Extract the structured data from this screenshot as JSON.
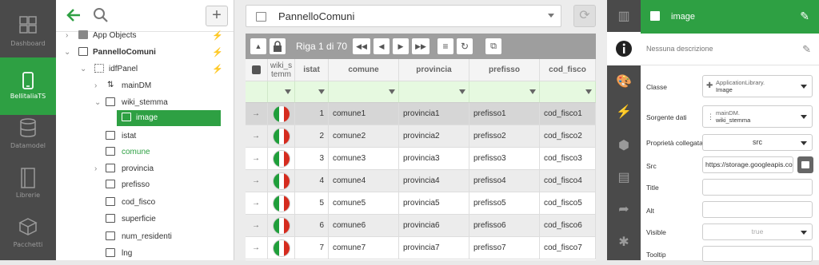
{
  "leftnav": {
    "items": [
      {
        "label": "Dashboard",
        "icon": "dashboard-icon",
        "active": false
      },
      {
        "label": "BellitaliaTS",
        "icon": "phone-icon",
        "active": true
      },
      {
        "label": "Datamodel",
        "icon": "database-icon",
        "active": false
      },
      {
        "label": "Librerie",
        "icon": "book-icon",
        "active": false
      },
      {
        "label": "Pacchetti",
        "icon": "package-icon",
        "active": false
      }
    ]
  },
  "tree": {
    "rows": [
      {
        "label": "App Objects",
        "indent": 1
      },
      {
        "label": "PannelloComuni",
        "indent": 1
      },
      {
        "label": "idfPanel",
        "indent": 2
      },
      {
        "label": "mainDM",
        "indent": 3
      },
      {
        "label": "wiki_stemma",
        "indent": 3
      },
      {
        "label": "image",
        "indent": 4
      },
      {
        "label": "istat",
        "indent": 3
      },
      {
        "label": "comune",
        "indent": 3
      },
      {
        "label": "provincia",
        "indent": 3
      },
      {
        "label": "prefisso",
        "indent": 3
      },
      {
        "label": "cod_fisco",
        "indent": 3
      },
      {
        "label": "superficie",
        "indent": 3
      },
      {
        "label": "num_residenti",
        "indent": 3
      },
      {
        "label": "lng",
        "indent": 3
      }
    ]
  },
  "center": {
    "panel_name": "PannelloComuni",
    "toolbar_text": "Riga 1 di 70",
    "columns": [
      "wiki_s temm",
      "istat",
      "comune",
      "provincia",
      "prefisso",
      "cod_fisco"
    ],
    "rows": [
      {
        "istat": "1",
        "comune": "comune1",
        "provincia": "provincia1",
        "prefisso": "prefisso1",
        "cod_fisco": "cod_fisco1"
      },
      {
        "istat": "2",
        "comune": "comune2",
        "provincia": "provincia2",
        "prefisso": "prefisso2",
        "cod_fisco": "cod_fisco2"
      },
      {
        "istat": "3",
        "comune": "comune3",
        "provincia": "provincia3",
        "prefisso": "prefisso3",
        "cod_fisco": "cod_fisco3"
      },
      {
        "istat": "4",
        "comune": "comune4",
        "provincia": "provincia4",
        "prefisso": "prefisso4",
        "cod_fisco": "cod_fisco4"
      },
      {
        "istat": "5",
        "comune": "comune5",
        "provincia": "provincia5",
        "prefisso": "prefisso5",
        "cod_fisco": "cod_fisco5"
      },
      {
        "istat": "6",
        "comune": "comune6",
        "provincia": "provincia6",
        "prefisso": "prefisso6",
        "cod_fisco": "cod_fisco6"
      },
      {
        "istat": "7",
        "comune": "comune7",
        "provincia": "provincia7",
        "prefisso": "prefisso7",
        "cod_fisco": "cod_fisco7"
      }
    ]
  },
  "props": {
    "title": "image",
    "description": "Nessuna descrizione",
    "classe_label": "Classe",
    "classe_v1": "ApplicationLibrary.",
    "classe_v2": "Image",
    "sorgente_label": "Sorgente dati",
    "sorgente_v1": "mainDM.",
    "sorgente_v2": "wiki_stemma",
    "proprieta_label": "Proprietà collegata",
    "proprieta_value": "src",
    "src_label": "Src",
    "src_value": "https://storage.googleapis.co",
    "title_label": "Title",
    "alt_label": "Alt",
    "visible_label": "Visible",
    "visible_value": "true",
    "tooltip_label": "Tooltip"
  },
  "colors": {
    "accent": "#2ea043",
    "sidebar": "#4a4a4a",
    "filter_row": "#e6f9e0"
  }
}
